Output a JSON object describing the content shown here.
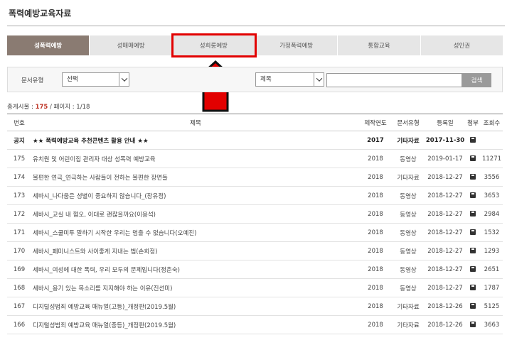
{
  "page": {
    "title": "폭력예방교육자료"
  },
  "tabs": [
    {
      "label": "성폭력예방",
      "active": true
    },
    {
      "label": "성매매예방",
      "active": false
    },
    {
      "label": "성희롱예방",
      "active": false
    },
    {
      "label": "가정폭력예방",
      "active": false
    },
    {
      "label": "통합교육",
      "active": false
    },
    {
      "label": "성인권",
      "active": false
    }
  ],
  "search": {
    "doc_type_label": "문서유형",
    "doc_type_value": "선택",
    "field_value": "제목",
    "query_value": "",
    "button_label": "검색"
  },
  "summary": {
    "prefix": "총게시물 : ",
    "count": "175",
    "suffix": " / 페이지 : 1/18"
  },
  "table": {
    "headers": [
      "번호",
      "제목",
      "제작연도",
      "문서유형",
      "등록일",
      "첨부",
      "조회수"
    ],
    "rows": [
      {
        "no": "공지",
        "title": "★★ 폭력예방교육 추천콘텐츠 활용 안내 ★★",
        "year": "2017",
        "type": "기타자료",
        "date": "2017-11-30",
        "views": "",
        "notice": true
      },
      {
        "no": "175",
        "title": "유치원 및 어린이집 관리자 대상 성폭력 예방교육",
        "year": "2018",
        "type": "동영상",
        "date": "2019-01-17",
        "views": "11271"
      },
      {
        "no": "174",
        "title": "불편한 연극_연극하는 사람들이 전하는 불편한 장면들",
        "year": "2018",
        "type": "기타자료",
        "date": "2018-12-27",
        "views": "3556"
      },
      {
        "no": "173",
        "title": "세바시_나다움은 성별이 중요하지 않습니다_(장유정)",
        "year": "2018",
        "type": "동영상",
        "date": "2018-12-27",
        "views": "3653"
      },
      {
        "no": "172",
        "title": "세바시_교실 내 혐오, 이대로 괜찮을까요(이용석)",
        "year": "2018",
        "type": "동영상",
        "date": "2018-12-27",
        "views": "2984"
      },
      {
        "no": "171",
        "title": "세바시_스쿨미투 말하기 시작한 우리는 멈출 수 없습니다(오예진)",
        "year": "2018",
        "type": "동영상",
        "date": "2018-12-27",
        "views": "1532"
      },
      {
        "no": "170",
        "title": "세바시_페미니스트와 사이좋게 지내는 법(손희정)",
        "year": "2018",
        "type": "동영상",
        "date": "2018-12-27",
        "views": "1293"
      },
      {
        "no": "169",
        "title": "세바시_여성에 대한 폭력, 우리 모두의 문제입니다(정춘숙)",
        "year": "2018",
        "type": "동영상",
        "date": "2018-12-27",
        "views": "2651"
      },
      {
        "no": "168",
        "title": "세바시_용기 있는 목소리를 지지해야 하는 이유(진선미)",
        "year": "2018",
        "type": "동영상",
        "date": "2018-12-27",
        "views": "1787"
      },
      {
        "no": "167",
        "title": "디지털성범죄 예방교육 매뉴얼(고등)_개정판(2019.5월)",
        "year": "2018",
        "type": "기타자료",
        "date": "2018-12-26",
        "views": "5125"
      },
      {
        "no": "166",
        "title": "디지털성범죄 예방교육 매뉴얼(중등)_개정판(2019.5월)",
        "year": "2018",
        "type": "기타자료",
        "date": "2018-12-26",
        "views": "3663"
      }
    ]
  },
  "annotation": {
    "highlight_color": "#e20000"
  }
}
